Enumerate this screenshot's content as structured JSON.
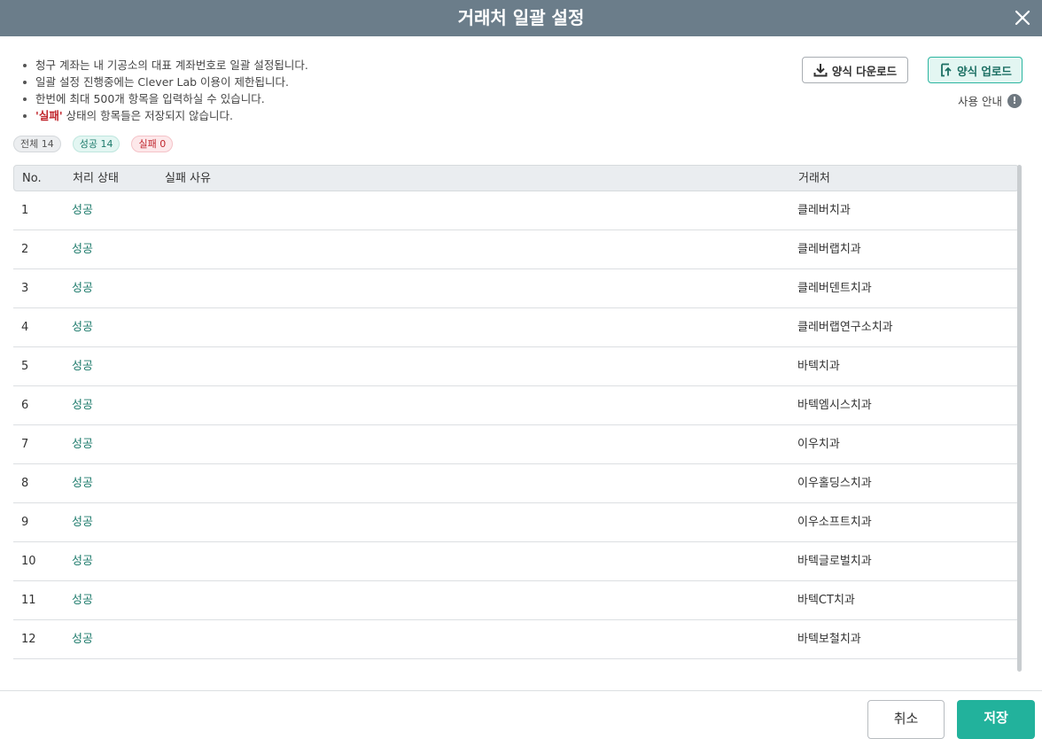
{
  "dialog": {
    "title": "거래처 일괄 설정"
  },
  "notes": {
    "line1": "청구 계좌는 내 기공소의 대표 계좌번호로 일괄 설정됩니다.",
    "line2": "일괄 설정 진행중에는 Clever Lab 이용이 제한됩니다.",
    "line3": "한번에 최대 500개 항목을 입력하실 수 있습니다.",
    "line4_highlight": "'실패'",
    "line4_rest": " 상태의 항목들은 저장되지 않습니다."
  },
  "actions": {
    "download_label": "양식 다운로드",
    "upload_label": "양식 업로드",
    "guide_label": "사용 안내",
    "guide_icon": "!"
  },
  "badges": {
    "all": "전체 14",
    "success": "성공 14",
    "fail": "실패 0"
  },
  "table": {
    "headers": {
      "no": "No.",
      "status": "처리 상태",
      "reason": "실패 사유",
      "vendor": "거래처"
    },
    "rows": [
      {
        "no": "1",
        "status": "성공",
        "reason": "",
        "vendor": "클레버치과"
      },
      {
        "no": "2",
        "status": "성공",
        "reason": "",
        "vendor": "클레버랩치과"
      },
      {
        "no": "3",
        "status": "성공",
        "reason": "",
        "vendor": "클레버덴트치과"
      },
      {
        "no": "4",
        "status": "성공",
        "reason": "",
        "vendor": "클레버랩연구소치과"
      },
      {
        "no": "5",
        "status": "성공",
        "reason": "",
        "vendor": "바텍치과"
      },
      {
        "no": "6",
        "status": "성공",
        "reason": "",
        "vendor": "바텍엠시스치과"
      },
      {
        "no": "7",
        "status": "성공",
        "reason": "",
        "vendor": "이우치과"
      },
      {
        "no": "8",
        "status": "성공",
        "reason": "",
        "vendor": "이우홀딩스치과"
      },
      {
        "no": "9",
        "status": "성공",
        "reason": "",
        "vendor": "이우소프트치과"
      },
      {
        "no": "10",
        "status": "성공",
        "reason": "",
        "vendor": "바텍글로벌치과"
      },
      {
        "no": "11",
        "status": "성공",
        "reason": "",
        "vendor": "바텍CT치과"
      },
      {
        "no": "12",
        "status": "성공",
        "reason": "",
        "vendor": "바텍보철치과"
      }
    ]
  },
  "footer": {
    "cancel_label": "취소",
    "save_label": "저장"
  },
  "colors": {
    "header": "#6b7d8a",
    "accent": "#22b29c",
    "fail": "#c0262d"
  }
}
